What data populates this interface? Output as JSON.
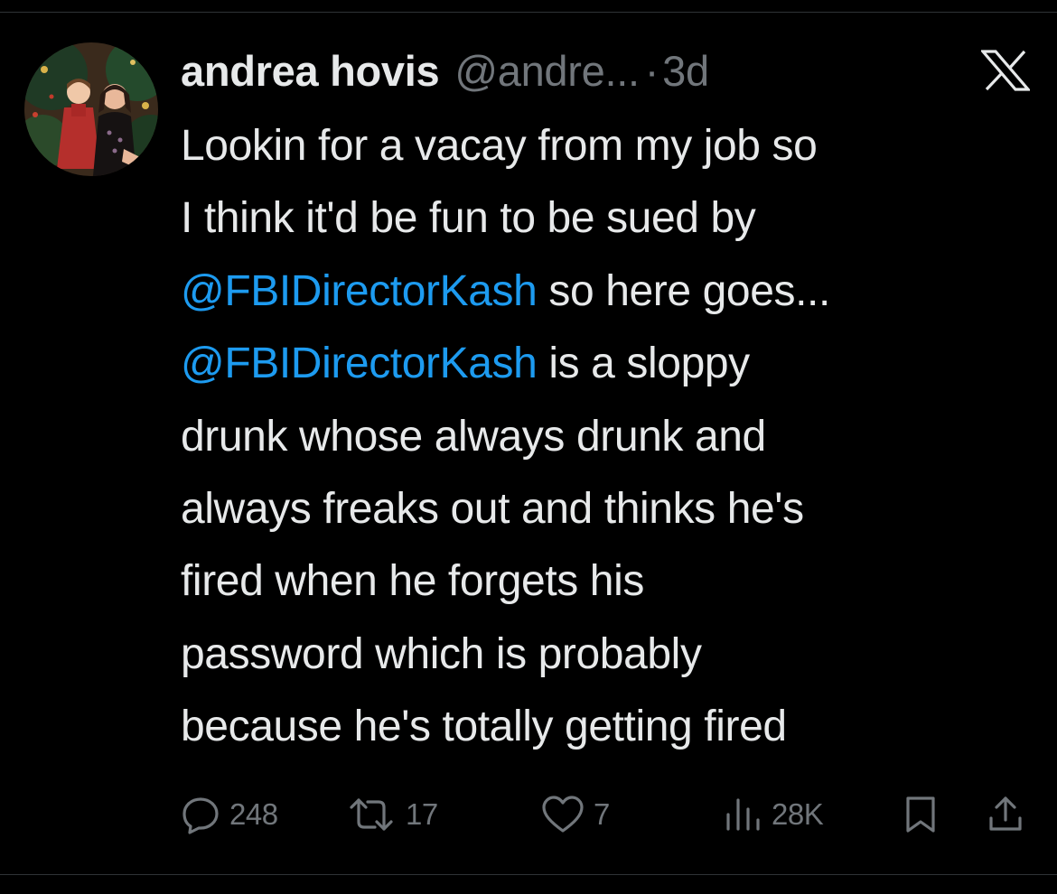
{
  "author": {
    "display_name": "andrea hovis",
    "handle": "@andre...",
    "separator": "·",
    "time": "3d"
  },
  "tweet": {
    "lines": [
      [
        {
          "text": "Lookin for a vacay from my job so",
          "mention": false
        }
      ],
      [
        {
          "text": "I think it'd be fun to be sued by",
          "mention": false
        }
      ],
      [
        {
          "text": "@FBIDirectorKash",
          "mention": true
        },
        {
          "text": " so here goes...",
          "mention": false
        }
      ],
      [
        {
          "text": "@FBIDirectorKash",
          "mention": true
        },
        {
          "text": " is a sloppy",
          "mention": false
        }
      ],
      [
        {
          "text": "drunk whose always drunk and",
          "mention": false
        }
      ],
      [
        {
          "text": "always freaks out and thinks he's",
          "mention": false
        }
      ],
      [
        {
          "text": "fired when he forgets his",
          "mention": false
        }
      ],
      [
        {
          "text": "password which is probably",
          "mention": false
        }
      ],
      [
        {
          "text": "because he's totally getting fired",
          "mention": false
        }
      ]
    ]
  },
  "actions": {
    "replies": "248",
    "reposts": "17",
    "likes": "7",
    "views": "28K"
  },
  "icons": {
    "platform": "x-logo-icon",
    "reply": "reply-bubble-icon",
    "repost": "repost-arrows-icon",
    "like": "heart-icon",
    "views": "views-bar-chart-icon",
    "bookmark": "bookmark-icon",
    "share": "share-upload-icon"
  },
  "colors": {
    "background": "#000000",
    "text_primary": "#e7e9ea",
    "text_secondary": "#71767b",
    "mention": "#1d9bf0"
  }
}
